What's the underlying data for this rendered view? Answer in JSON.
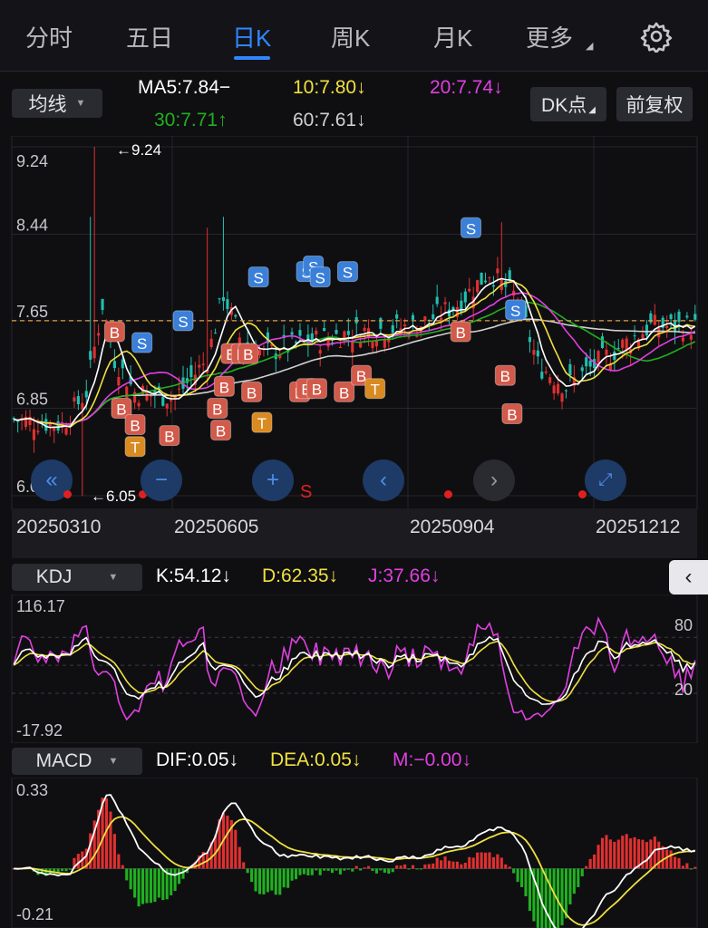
{
  "tabs": [
    {
      "label": "分时",
      "active": false
    },
    {
      "label": "五日",
      "active": false
    },
    {
      "label": "日K",
      "active": true
    },
    {
      "label": "周K",
      "active": false
    },
    {
      "label": "月K",
      "active": false
    },
    {
      "label": "更多",
      "active": false
    }
  ],
  "settings_icon": "gear-icon",
  "ma_bar": {
    "selector": "均线",
    "ma5": "MA5:7.84−",
    "ma10": "10:7.80↓",
    "ma20": "20:7.74↓",
    "ma30": "30:7.71↑",
    "ma60": "60:7.61↓",
    "dk_button": "DK点",
    "adjust_button": "前复权"
  },
  "colors": {
    "ma5": "#ffffff",
    "ma10": "#f0e040",
    "ma20": "#e040e0",
    "ma30": "#20b020",
    "ma60": "#d0d0d0",
    "up": "#e03030",
    "down": "#20c0b0",
    "buy": "#d25a4a",
    "sell": "#3a7fd8",
    "t": "#d98a20",
    "accent": "#2f86ff"
  },
  "chart_data": [
    {
      "type": "candlestick",
      "title": "日K",
      "ylim": [
        6.05,
        9.24
      ],
      "y_ticks": [
        "9.24",
        "8.44",
        "7.65",
        "6.85",
        "6.05"
      ],
      "high_marker": "←9.24",
      "low_marker": "←6.05",
      "reference_line": 7.65,
      "dates": [
        "20250310",
        "20250605",
        "20250904",
        "20251212"
      ],
      "signal_labels": {
        "buy": "B",
        "sell": "S",
        "t": "T"
      },
      "signals": [
        {
          "type": "B",
          "x": 0.15,
          "price": 7.55
        },
        {
          "type": "B",
          "x": 0.16,
          "price": 6.85
        },
        {
          "type": "B",
          "x": 0.18,
          "price": 6.7
        },
        {
          "type": "T",
          "x": 0.18,
          "price": 6.5
        },
        {
          "type": "B",
          "x": 0.23,
          "price": 6.6
        },
        {
          "type": "S",
          "x": 0.19,
          "price": 7.45
        },
        {
          "type": "S",
          "x": 0.25,
          "price": 7.65
        },
        {
          "type": "B",
          "x": 0.31,
          "price": 7.05
        },
        {
          "type": "B",
          "x": 0.3,
          "price": 6.85
        },
        {
          "type": "B",
          "x": 0.305,
          "price": 6.65
        },
        {
          "type": "B",
          "x": 0.32,
          "price": 7.35
        },
        {
          "type": "B",
          "x": 0.335,
          "price": 7.35
        },
        {
          "type": "B",
          "x": 0.345,
          "price": 7.35
        },
        {
          "type": "B",
          "x": 0.35,
          "price": 7.0
        },
        {
          "type": "T",
          "x": 0.365,
          "price": 6.72
        },
        {
          "type": "S",
          "x": 0.36,
          "price": 8.05
        },
        {
          "type": "S",
          "x": 0.43,
          "price": 8.1
        },
        {
          "type": "S",
          "x": 0.44,
          "price": 8.15
        },
        {
          "type": "S",
          "x": 0.45,
          "price": 8.05
        },
        {
          "type": "S",
          "x": 0.49,
          "price": 8.1
        },
        {
          "type": "B",
          "x": 0.42,
          "price": 7.0
        },
        {
          "type": "B",
          "x": 0.43,
          "price": 7.03
        },
        {
          "type": "B",
          "x": 0.445,
          "price": 7.03
        },
        {
          "type": "B",
          "x": 0.485,
          "price": 7.0
        },
        {
          "type": "B",
          "x": 0.51,
          "price": 7.15
        },
        {
          "type": "T",
          "x": 0.53,
          "price": 7.03
        },
        {
          "type": "S",
          "x": 0.67,
          "price": 8.5
        },
        {
          "type": "B",
          "x": 0.655,
          "price": 7.55
        },
        {
          "type": "S",
          "x": 0.735,
          "price": 7.75
        },
        {
          "type": "B",
          "x": 0.72,
          "price": 7.15
        },
        {
          "type": "B",
          "x": 0.73,
          "price": 6.8
        }
      ],
      "controls": [
        "double-left-icon",
        "zoom-out-icon",
        "zoom-in-icon",
        "prev-icon",
        "next-icon",
        "fullscreen-icon"
      ],
      "s_label": "S"
    },
    {
      "type": "line",
      "title": "KDJ",
      "indicator": "KDJ",
      "selector": "KDJ",
      "values_text": {
        "k": "K:54.12↓",
        "d": "D:62.35↓",
        "j": "J:37.66↓"
      },
      "ylim": [
        -17.92,
        116.17
      ],
      "y_ticks": [
        "116.17",
        "-17.92"
      ],
      "ref_labels": [
        "80",
        "20"
      ],
      "series": [
        {
          "name": "K",
          "color": "#ffffff"
        },
        {
          "name": "D",
          "color": "#f0e040"
        },
        {
          "name": "J",
          "color": "#e040e0"
        }
      ]
    },
    {
      "type": "bar",
      "title": "MACD",
      "indicator": "MACD",
      "selector": "MACD",
      "values_text": {
        "dif": "DIF:0.05↓",
        "dea": "DEA:0.05↓",
        "m": "M:−0.00↓"
      },
      "ylim": [
        -0.21,
        0.33
      ],
      "y_ticks": [
        "0.33",
        "-0.21"
      ],
      "series": [
        {
          "name": "DIF",
          "color": "#ffffff"
        },
        {
          "name": "DEA",
          "color": "#f0e040"
        }
      ]
    }
  ]
}
